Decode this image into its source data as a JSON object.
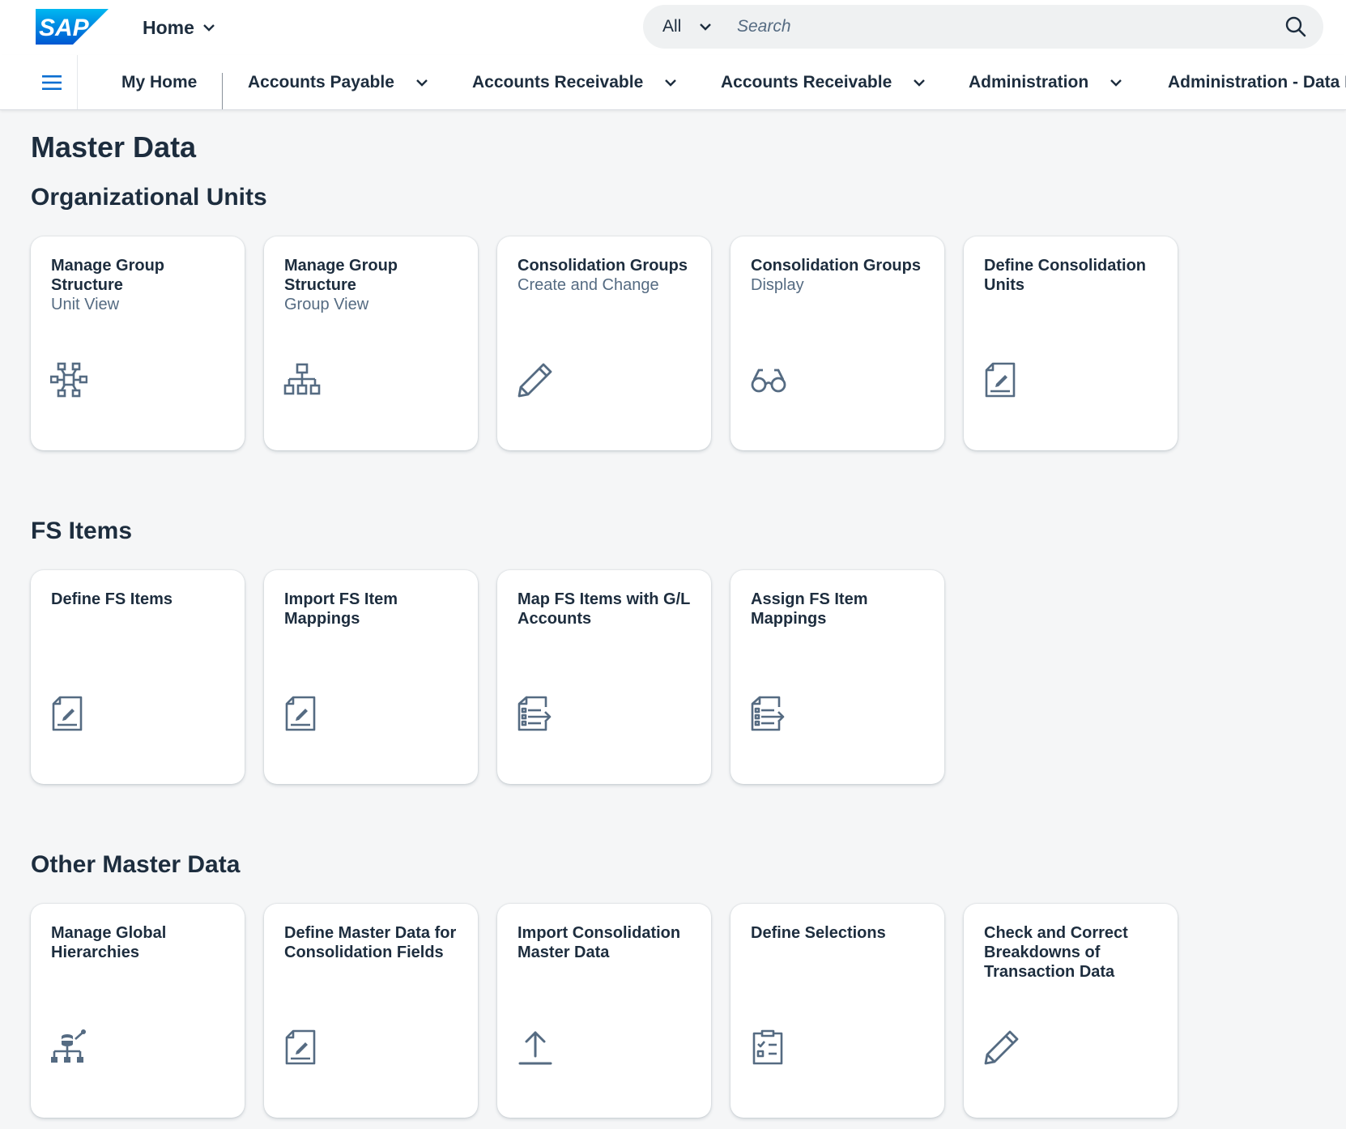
{
  "header": {
    "logo_text": "SAP",
    "home_label": "Home",
    "search_scope": "All",
    "search_placeholder": "Search"
  },
  "tabs": [
    {
      "label": "My Home",
      "has_menu": false
    },
    {
      "label": "Accounts Payable",
      "has_menu": true
    },
    {
      "label": "Accounts Receivable",
      "has_menu": true
    },
    {
      "label": "Accounts Receivable",
      "has_menu": true
    },
    {
      "label": "Administration",
      "has_menu": true
    },
    {
      "label": "Administration - Data I",
      "has_menu": false
    }
  ],
  "page": {
    "title": "Master Data"
  },
  "sections": [
    {
      "title": "Organizational Units",
      "tiles": [
        {
          "title": "Manage Group Structure",
          "subtitle": "Unit View",
          "icon": "network-icon"
        },
        {
          "title": "Manage Group Structure",
          "subtitle": "Group View",
          "icon": "org-chart-icon"
        },
        {
          "title": "Consolidation Groups",
          "subtitle": "Create and Change",
          "icon": "pencil-icon"
        },
        {
          "title": "Consolidation Groups",
          "subtitle": "Display",
          "icon": "glasses-icon"
        },
        {
          "title": "Define Consolidation Units",
          "subtitle": "",
          "icon": "document-edit-icon"
        }
      ]
    },
    {
      "title": "FS Items",
      "tiles": [
        {
          "title": "Define FS Items",
          "subtitle": "",
          "icon": "document-edit-icon"
        },
        {
          "title": "Import FS Item Mappings",
          "subtitle": "",
          "icon": "document-edit-icon"
        },
        {
          "title": "Map FS Items with G/L Accounts",
          "subtitle": "",
          "icon": "list-arrow-icon"
        },
        {
          "title": "Assign FS Item Mappings",
          "subtitle": "",
          "icon": "list-arrow-icon"
        }
      ]
    },
    {
      "title": "Other Master Data",
      "tiles": [
        {
          "title": "Manage Global Hierarchies",
          "subtitle": "",
          "icon": "hierarchy-database-icon"
        },
        {
          "title": "Define Master Data for Consolidation Fields",
          "subtitle": "",
          "icon": "document-edit-icon"
        },
        {
          "title": "Import Consolidation Master Data",
          "subtitle": "",
          "icon": "upload-icon"
        },
        {
          "title": "Define Selections",
          "subtitle": "",
          "icon": "checklist-icon"
        },
        {
          "title": "Check and Correct Breakdowns of Transaction Data",
          "subtitle": "",
          "icon": "pencil-icon"
        }
      ]
    }
  ],
  "colors": {
    "brand": "#0070f2",
    "text": "#1d2d3e",
    "icon": "#556b82",
    "background": "#f5f6f7"
  }
}
